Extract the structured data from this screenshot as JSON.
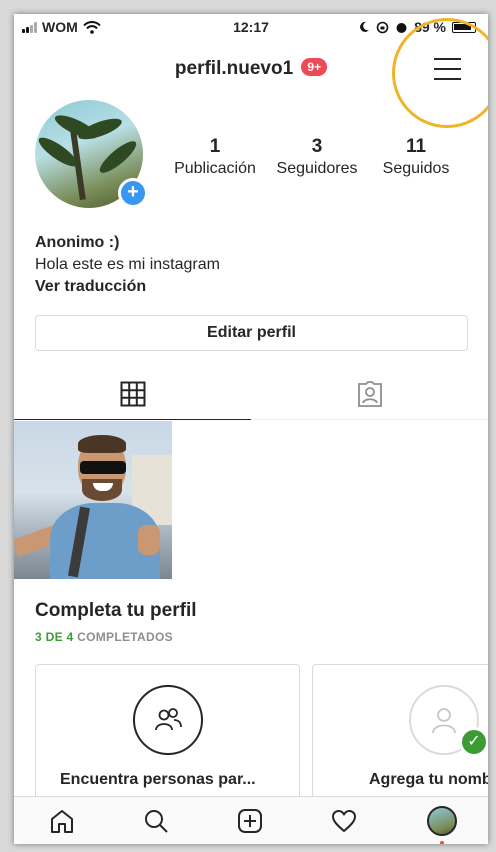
{
  "status_bar": {
    "carrier": "WOM",
    "time": "12:17",
    "battery": "89 %"
  },
  "header": {
    "username": "perfil.nuevo1",
    "notification_badge": "9+"
  },
  "profile": {
    "stats": [
      {
        "value": "1",
        "label": "Publicación"
      },
      {
        "value": "3",
        "label": "Seguidores"
      },
      {
        "value": "11",
        "label": "Seguidos"
      }
    ],
    "name": "Anonimo :)",
    "bio": "Hola este es mi instagram",
    "translate_link": "Ver traducción",
    "edit_button": "Editar perfil"
  },
  "complete_profile": {
    "title": "Completa tu perfil",
    "progress_done": "3 DE 4",
    "progress_label": "COMPLETADOS",
    "cards": [
      {
        "label": "Encuentra personas par...",
        "icon": "people-icon",
        "completed": false
      },
      {
        "label": "Agrega tu nombre",
        "icon": "user-icon",
        "completed": true
      }
    ]
  },
  "colors": {
    "badge": "#ed4956",
    "accent_blue": "#3897f0",
    "completed_green": "#3d9b35",
    "highlight_ring": "#f0b429"
  }
}
